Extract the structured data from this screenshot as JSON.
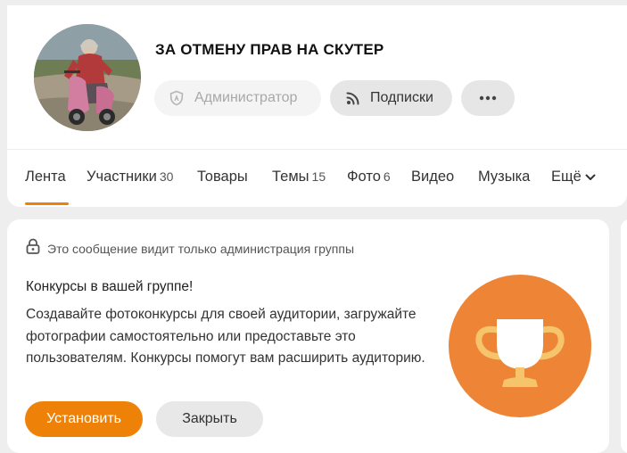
{
  "group": {
    "title": "ЗА ОТМЕНУ ПРАВ НА СКУТЕР",
    "admin_label": "Администратор",
    "subscriptions_label": "Подписки",
    "more_label": "•••"
  },
  "tabs": [
    {
      "label": "Лента",
      "count": ""
    },
    {
      "label": "Участники",
      "count": "30"
    },
    {
      "label": "Товары",
      "count": ""
    },
    {
      "label": "Темы",
      "count": "15"
    },
    {
      "label": "Фото",
      "count": "6"
    },
    {
      "label": "Видео",
      "count": ""
    },
    {
      "label": "Музыка",
      "count": ""
    },
    {
      "label": "Ещё",
      "count": ""
    }
  ],
  "promo": {
    "admin_note": "Это сообщение видит только администрация группы",
    "heading": "Конкурсы в вашей группе!",
    "body": "Создавайте фотоконкурсы для своей аудитории, загружайте фотографии самостоятельно или предоставьте это пользователям. Конкурсы помогут вам расширить аудиторию.",
    "install_label": "Установить",
    "close_label": "Закрыть"
  },
  "colors": {
    "accent": "#ee8208",
    "trophy_bg": "#ee8435",
    "background": "#eeeeee"
  },
  "icons": [
    "admin-shield-icon",
    "rss-icon",
    "more-dots-icon",
    "chevron-down-icon",
    "lock-icon",
    "trophy-icon"
  ]
}
